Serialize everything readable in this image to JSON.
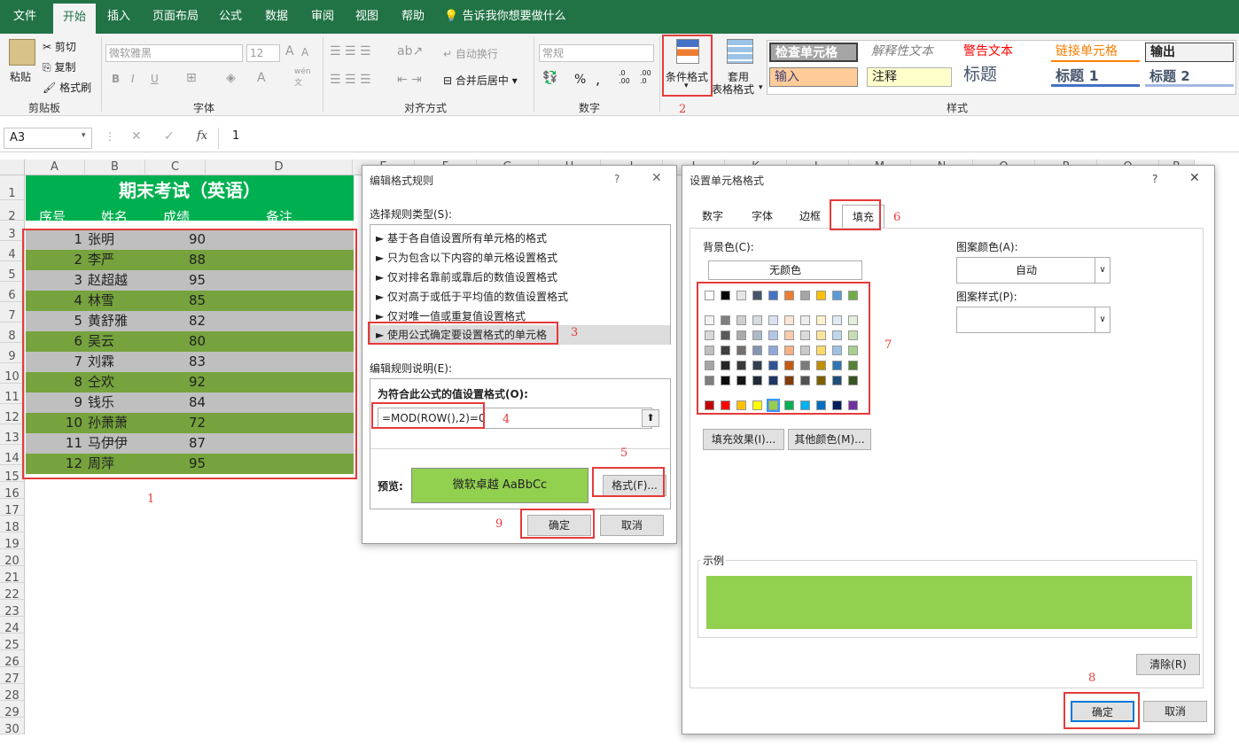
{
  "menu": {
    "items": [
      "文件",
      "开始",
      "插入",
      "页面布局",
      "公式",
      "数据",
      "审阅",
      "视图",
      "帮助"
    ],
    "tell_me": "告诉我你想要做什么"
  },
  "ribbon": {
    "clipboard": {
      "paste": "粘贴",
      "cut": "剪切",
      "copy": "复制",
      "format_painter": "格式刷",
      "label": "剪贴板"
    },
    "font": {
      "family": "微软雅黑",
      "size": "12",
      "bold": "B",
      "italic": "I",
      "underline": "U",
      "grow": "A",
      "shrink": "A",
      "wen": "wén",
      "wen2": "文",
      "label": "字体"
    },
    "align": {
      "wrap": "自动换行",
      "merge": "合并后居中",
      "label": "对齐方式"
    },
    "number": {
      "format": "常规",
      "percent": "%",
      "comma": ",",
      "inc": ".0\n.00",
      "dec": ".00\n→.0",
      "label": "数字"
    },
    "cond_format": "条件格式",
    "table_format_1": "套用",
    "table_format_2": "表格格式",
    "styles": {
      "check": "检查单元格",
      "explain": "解释性文本",
      "warn": "警告文本",
      "link": "链接单元格",
      "output": "输出",
      "input": "输入",
      "note": "注释",
      "title": "标题",
      "h1": "标题 1",
      "h2": "标题 2",
      "label": "样式"
    }
  },
  "formula_bar": {
    "name_box": "A3",
    "cancel": "✕",
    "confirm": "✓",
    "fx": "fx",
    "value": "1"
  },
  "sheet": {
    "columns": [
      "A",
      "B",
      "C",
      "D",
      "E",
      "F",
      "G",
      "H",
      "I",
      "J",
      "K",
      "L",
      "M",
      "N",
      "O",
      "P",
      "Q",
      "R"
    ],
    "title": "期末考试（英语）",
    "headers": {
      "seq": "序号",
      "name": "姓名",
      "score": "成绩",
      "note": "备注"
    },
    "rows": [
      {
        "seq": "1",
        "name": "张明",
        "score": "90"
      },
      {
        "seq": "2",
        "name": "李严",
        "score": "88"
      },
      {
        "seq": "3",
        "name": "赵超越",
        "score": "95"
      },
      {
        "seq": "4",
        "name": "林雪",
        "score": "85"
      },
      {
        "seq": "5",
        "name": "黄舒雅",
        "score": "82"
      },
      {
        "seq": "6",
        "name": "吴云",
        "score": "80"
      },
      {
        "seq": "7",
        "name": "刘霖",
        "score": "83"
      },
      {
        "seq": "8",
        "name": "仝欢",
        "score": "92"
      },
      {
        "seq": "9",
        "name": "钱乐",
        "score": "84"
      },
      {
        "seq": "10",
        "name": "孙萧萧",
        "score": "72"
      },
      {
        "seq": "11",
        "name": "马伊伊",
        "score": "87"
      },
      {
        "seq": "12",
        "name": "周萍",
        "score": "95"
      }
    ],
    "row_numbers": [
      "1",
      "2",
      "3",
      "4",
      "5",
      "6",
      "7",
      "8",
      "9",
      "10",
      "11",
      "12",
      "13",
      "14",
      "15",
      "16",
      "17",
      "18",
      "19",
      "20",
      "21",
      "22",
      "23",
      "24",
      "25",
      "26",
      "27",
      "28",
      "29",
      "30"
    ],
    "colors": {
      "header_green": "#00b050",
      "band_gray": "#bfbfbf",
      "band_green": "#76a33d"
    }
  },
  "edit_rule_dialog": {
    "title": "编辑格式规则",
    "help": "?",
    "close": "✕",
    "select_type_label": "选择规则类型(S):",
    "rule_types": [
      "► 基于各自值设置所有单元格的格式",
      "► 只为包含以下内容的单元格设置格式",
      "► 仅对排名靠前或靠后的数值设置格式",
      "► 仅对高于或低于平均值的数值设置格式",
      "► 仅对唯一值或重复值设置格式",
      "► 使用公式确定要设置格式的单元格"
    ],
    "desc_label": "编辑规则说明(E):",
    "formula_label": "为符合此公式的值设置格式(O):",
    "formula": "=MOD(ROW(),2)=0",
    "preview_label": "预览:",
    "preview_text": "微软卓越 AaBbCc",
    "format_button": "格式(F)...",
    "ok": "确定",
    "cancel": "取消"
  },
  "format_cells_dialog": {
    "title": "设置单元格格式",
    "help": "?",
    "close": "✕",
    "tabs": [
      "数字",
      "字体",
      "边框",
      "填充"
    ],
    "bg_color_label": "背景色(C):",
    "no_color": "无颜色",
    "pattern_color_label": "图案颜色(A):",
    "pattern_color_value": "自动",
    "pattern_style_label": "图案样式(P):",
    "fill_effects": "填充效果(I)...",
    "more_colors": "其他颜色(M)...",
    "sample_label": "示例",
    "sample_color": "#92d050",
    "clear": "清除(R)",
    "ok": "确定",
    "cancel": "取消",
    "theme_top": [
      "#ffffff",
      "#000000",
      "#e7e6e6",
      "#44546a",
      "#4472c4",
      "#ed7d31",
      "#a5a5a5",
      "#ffc000",
      "#5b9bd5",
      "#70ad47"
    ],
    "theme_shades": [
      [
        "#f2f2f2",
        "#7f7f7f",
        "#d0cece",
        "#d6dce4",
        "#d9e2f3",
        "#fbe5d5",
        "#ededed",
        "#fff2cc",
        "#deebf6",
        "#e2efd9"
      ],
      [
        "#d8d8d8",
        "#595959",
        "#aeaaaa",
        "#adb9ca",
        "#b4c6e7",
        "#f7cbac",
        "#dbdbdb",
        "#fee599",
        "#bdd7ee",
        "#c5e0b3"
      ],
      [
        "#bfbfbf",
        "#3f3f3f",
        "#757070",
        "#8496b0",
        "#8eaadb",
        "#f4b183",
        "#c9c9c9",
        "#ffd965",
        "#9cc3e5",
        "#a8d08d"
      ],
      [
        "#a5a5a5",
        "#262626",
        "#3a3838",
        "#323f4f",
        "#2f5496",
        "#c55a11",
        "#7b7b7b",
        "#bf8f00",
        "#2e75b5",
        "#538135"
      ],
      [
        "#7f7f7f",
        "#0c0c0c",
        "#171616",
        "#222a35",
        "#1f3864",
        "#833c0b",
        "#525252",
        "#7f6000",
        "#1e4e79",
        "#375623"
      ]
    ],
    "standard": [
      "#c00000",
      "#ff0000",
      "#ffc000",
      "#ffff00",
      "#92d050",
      "#00b050",
      "#00b0f0",
      "#0070c0",
      "#002060",
      "#7030a0"
    ]
  },
  "annotations": [
    "1",
    "2",
    "3",
    "4",
    "5",
    "6",
    "7",
    "8",
    "9"
  ]
}
